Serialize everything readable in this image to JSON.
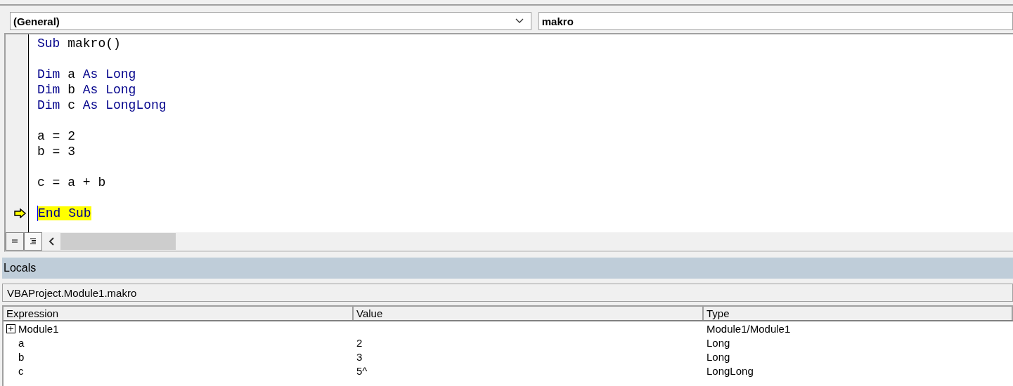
{
  "object_combo": {
    "value": "(General)"
  },
  "procedure_combo": {
    "value": "makro"
  },
  "code_lines": [
    {
      "current": false,
      "tokens": [
        {
          "kind": "keyword",
          "text": "Sub"
        },
        {
          "kind": "plain",
          "text": " makro()"
        }
      ]
    },
    {
      "current": false
    },
    {
      "current": false,
      "tokens": [
        {
          "kind": "keyword",
          "text": "Dim"
        },
        {
          "kind": "plain",
          "text": " a "
        },
        {
          "kind": "keyword",
          "text": "As Long"
        }
      ]
    },
    {
      "current": false,
      "tokens": [
        {
          "kind": "keyword",
          "text": "Dim"
        },
        {
          "kind": "plain",
          "text": " b "
        },
        {
          "kind": "keyword",
          "text": "As Long"
        }
      ]
    },
    {
      "current": false,
      "tokens": [
        {
          "kind": "keyword",
          "text": "Dim"
        },
        {
          "kind": "plain",
          "text": " c "
        },
        {
          "kind": "keyword",
          "text": "As LongLong"
        }
      ]
    },
    {
      "current": false
    },
    {
      "current": false,
      "tokens": [
        {
          "kind": "plain",
          "text": "a = 2"
        }
      ]
    },
    {
      "current": false,
      "tokens": [
        {
          "kind": "plain",
          "text": "b = 3"
        }
      ]
    },
    {
      "current": false
    },
    {
      "current": false,
      "tokens": [
        {
          "kind": "plain",
          "text": "c = a + b"
        }
      ]
    },
    {
      "current": false
    },
    {
      "current": true,
      "tokens": [
        {
          "kind": "keyword",
          "text": "End Sub"
        }
      ]
    }
  ],
  "locals": {
    "title": "Locals",
    "context": "VBAProject.Module1.makro",
    "columns": [
      "Expression",
      "Value",
      "Type"
    ],
    "rows": [
      {
        "kind": "object",
        "expanded": false,
        "expression": "Module1",
        "type": "Module1/Module1"
      },
      {
        "kind": "variable",
        "expression": "a",
        "value": "2",
        "type": "Long"
      },
      {
        "kind": "variable",
        "expression": "b",
        "value": "3",
        "type": "Long"
      },
      {
        "kind": "variable",
        "expression": "c",
        "value": "5^",
        "type": "LongLong"
      }
    ]
  }
}
